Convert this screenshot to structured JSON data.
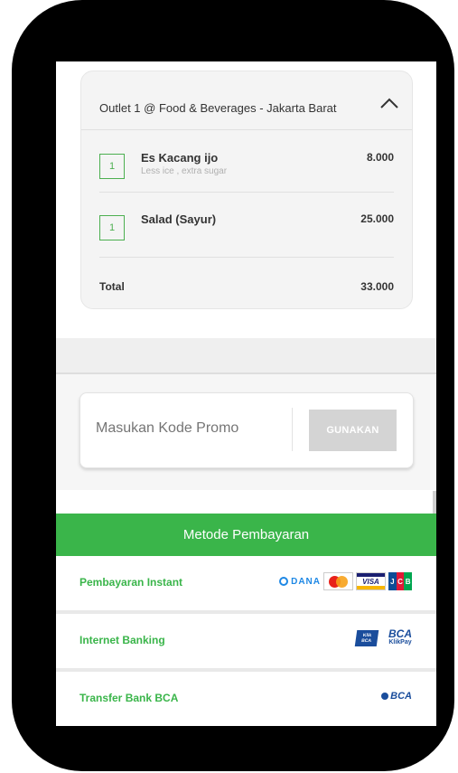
{
  "order": {
    "outlet_title": "Outlet 1 @ Food & Beverages - Jakarta Barat",
    "items": [
      {
        "qty": "1",
        "name": "Es Kacang ijo",
        "note": "Less ice , extra sugar",
        "price": "8.000"
      },
      {
        "qty": "1",
        "name": "Salad (Sayur)",
        "note": "",
        "price": "25.000"
      }
    ],
    "total_label": "Total",
    "total_value": "33.000"
  },
  "promo": {
    "placeholder": "Masukan Kode Promo",
    "button_label": "GUNAKAN"
  },
  "payment": {
    "header": "Metode Pembayaran",
    "methods": [
      {
        "label": "Pembayaran Instant",
        "logos": [
          "dana-logo",
          "mastercard-logo",
          "visa-logo",
          "jcb-logo"
        ]
      },
      {
        "label": "Internet Banking",
        "logos": [
          "klikbca-logo",
          "bca-klikpay-logo"
        ]
      },
      {
        "label": "Transfer Bank BCA",
        "logos": [
          "bca-logo"
        ]
      }
    ]
  },
  "logo_text": {
    "dana": "DANA",
    "visa": "VISA",
    "jcb": [
      "J",
      "C",
      "B"
    ],
    "klik": [
      "Klik",
      "BCA"
    ],
    "bca_klikpay": [
      "BCA",
      "KlikPay"
    ],
    "bca": "BCA"
  },
  "colors": {
    "accent_green": "#3ab54a",
    "quantity_border": "#4caf50",
    "promo_button_bg": "#d4d4d4"
  }
}
